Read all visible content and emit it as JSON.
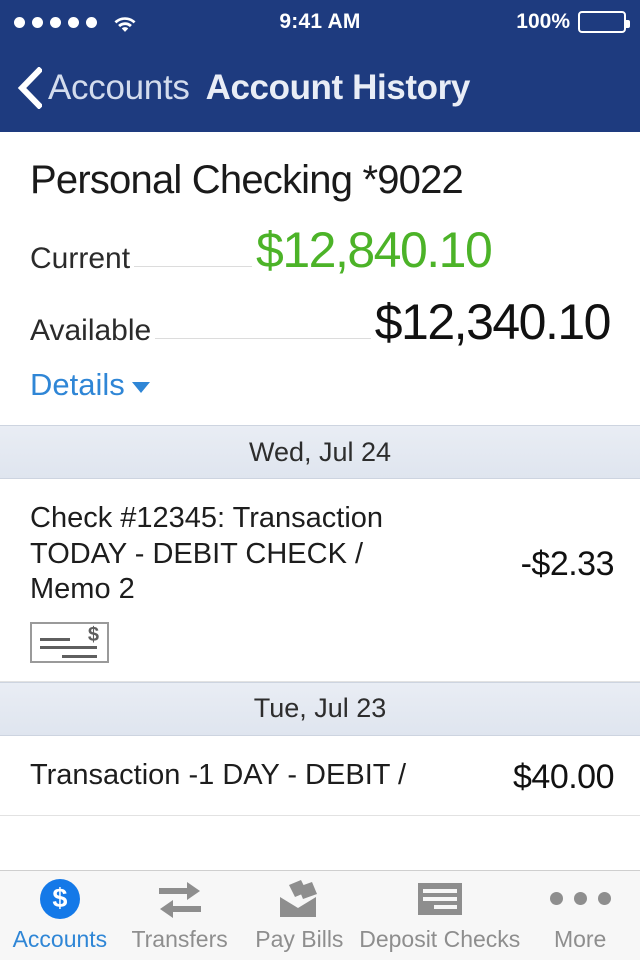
{
  "status_bar": {
    "signal_dots": 5,
    "wifi_icon": "wifi-icon",
    "time": "9:41 AM",
    "battery_percent": "100%",
    "battery_level": 100
  },
  "nav": {
    "back_icon": "chevron-left-icon",
    "back_label": "Accounts",
    "title": "Account History"
  },
  "account": {
    "name": "Personal Checking *9022",
    "balances": [
      {
        "label": "Current",
        "value": "$12,840.10",
        "color": "#4cb328"
      },
      {
        "label": "Available",
        "value": "$12,340.10",
        "color": "#111111"
      }
    ],
    "details_label": "Details",
    "details_caret_icon": "caret-down-icon"
  },
  "history": {
    "groups": [
      {
        "date": "Wed, Jul 24",
        "transactions": [
          {
            "description": "Check #12345: Transaction TODAY - DEBIT CHECK / Memo 2",
            "amount": "-$2.33",
            "icon": "check-image-icon",
            "icon_dollar": "$"
          }
        ]
      },
      {
        "date": "Tue, Jul 23",
        "transactions": [
          {
            "description": "Transaction -1 DAY - DEBIT /",
            "amount": "$40.00",
            "icon": "none",
            "icon_dollar": ""
          }
        ]
      }
    ]
  },
  "tabbar": {
    "items": [
      {
        "label": "Accounts",
        "icon": "dollar-coin-icon",
        "active": true
      },
      {
        "label": "Transfers",
        "icon": "transfer-arrows-icon",
        "active": false
      },
      {
        "label": "Pay Bills",
        "icon": "envelope-pen-icon",
        "active": false
      },
      {
        "label": "Deposit Checks",
        "icon": "deposit-check-icon",
        "active": false
      },
      {
        "label": "More",
        "icon": "ellipsis-icon",
        "active": false
      }
    ]
  },
  "colors": {
    "navbar": "#1e3b7f",
    "accent_blue": "#2f86d6",
    "positive_green": "#4cb328",
    "date_header_bg": "#e4e9f1"
  }
}
